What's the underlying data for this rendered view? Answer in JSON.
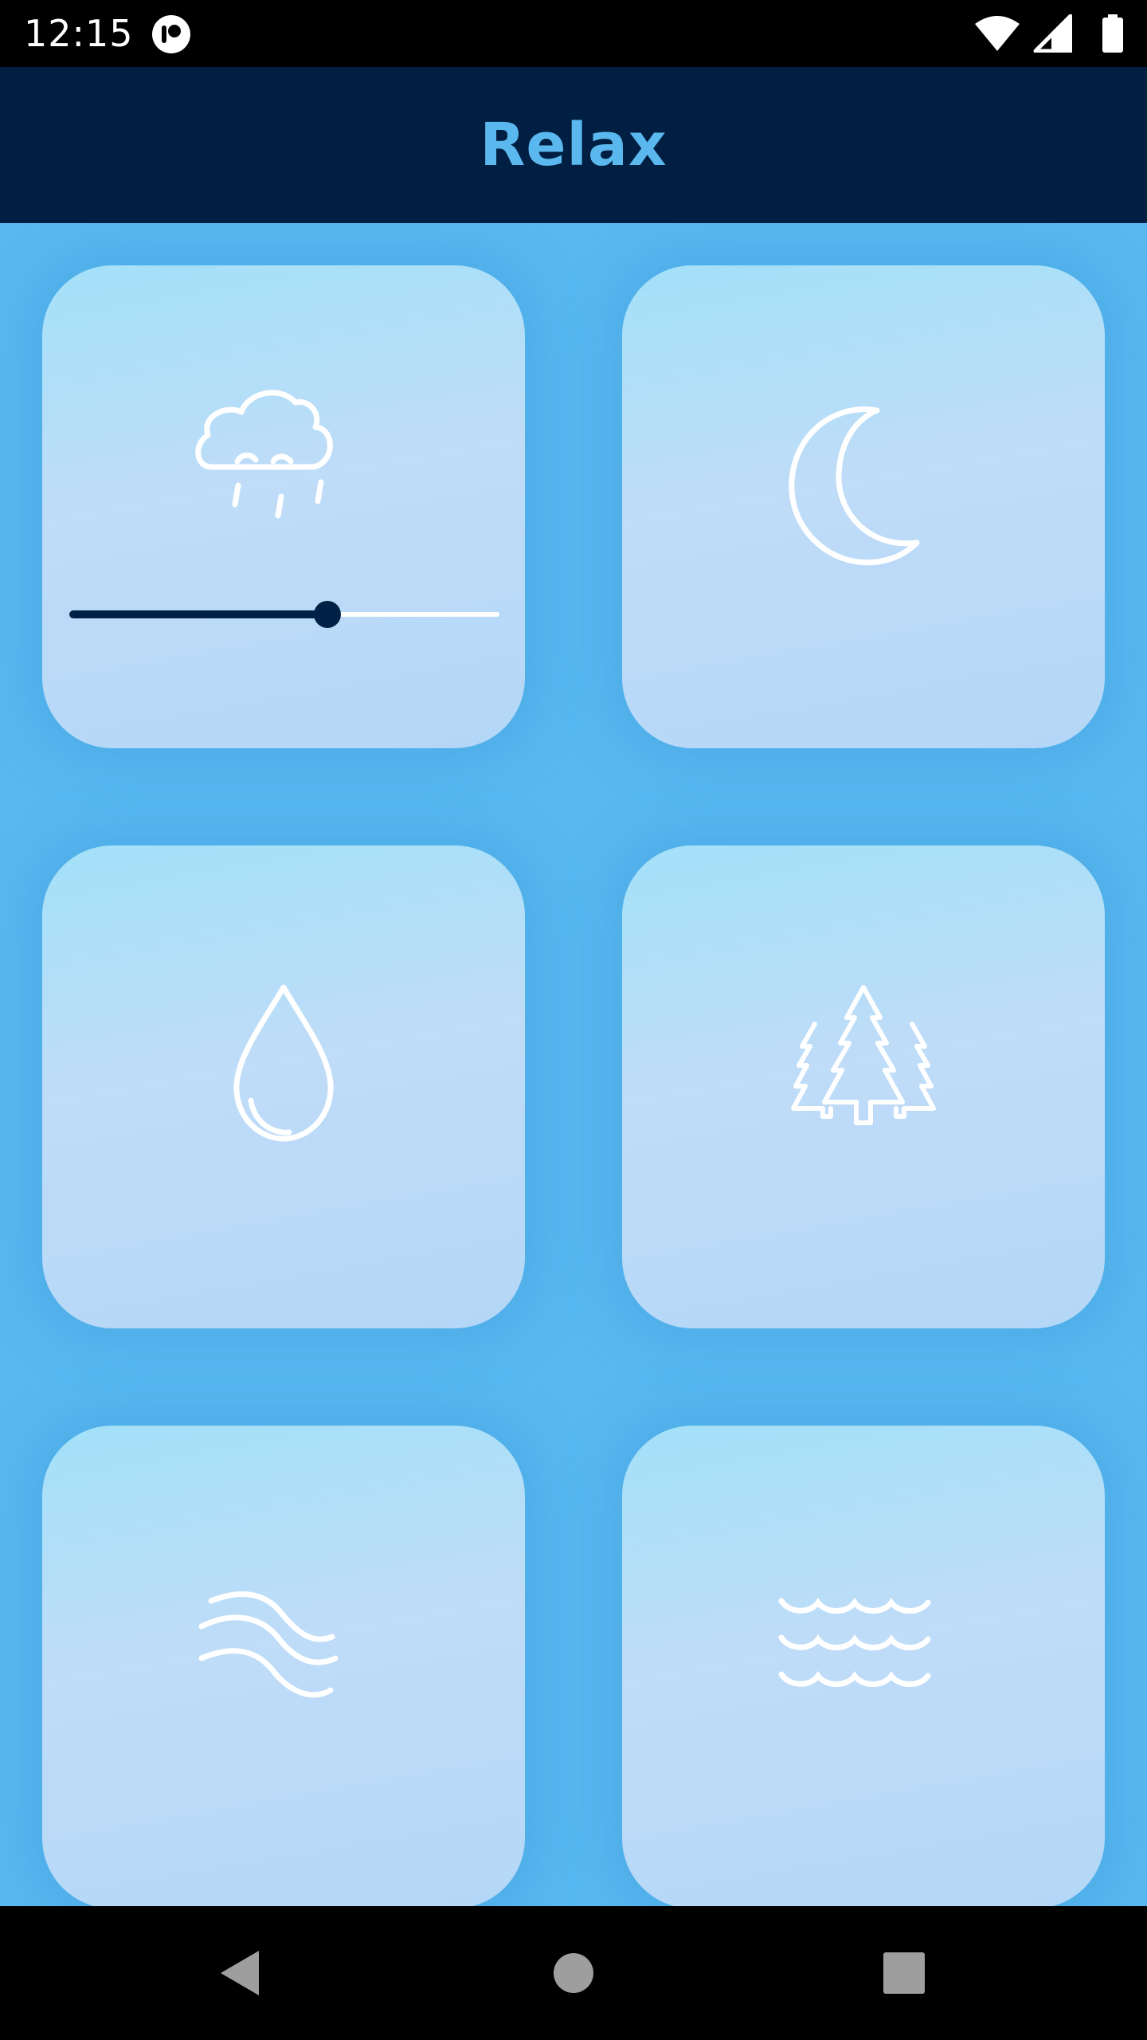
{
  "status_bar": {
    "time": "12:15",
    "icons": [
      "app-notification-icon",
      "wifi-icon",
      "cellular-signal-icon",
      "battery-icon"
    ]
  },
  "app_bar": {
    "title": "Relax",
    "title_color": "#5bb8ee",
    "background": "#001f42"
  },
  "tiles": [
    {
      "name": "rain",
      "icon": "cloud-rain-icon",
      "has_slider": true,
      "volume": 0.6
    },
    {
      "name": "night",
      "icon": "crescent-moon-icon",
      "has_slider": false
    },
    {
      "name": "water-drop",
      "icon": "water-drop-icon",
      "has_slider": false
    },
    {
      "name": "forest",
      "icon": "pine-trees-icon",
      "has_slider": false
    },
    {
      "name": "wind",
      "icon": "wind-icon",
      "has_slider": false
    },
    {
      "name": "waves",
      "icon": "waves-icon",
      "has_slider": false
    }
  ],
  "colors": {
    "content_background": "#58b9f0",
    "slider_active": "#022147",
    "slider_inactive": "#ffffff",
    "icon_stroke": "#ffffff"
  },
  "nav_bar": {
    "buttons": [
      "back-icon",
      "home-icon",
      "recents-icon"
    ]
  }
}
